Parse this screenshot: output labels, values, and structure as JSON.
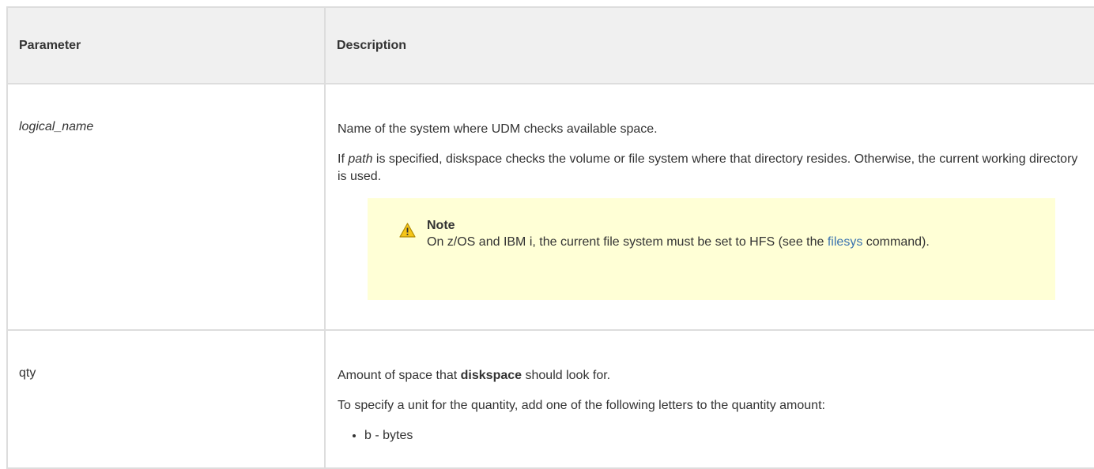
{
  "table": {
    "headers": {
      "parameter": "Parameter",
      "description": "Description"
    },
    "rows": [
      {
        "parameter": "logical_name",
        "description_1": "Name of the system where UDM checks available space.",
        "description_2_pre": "If ",
        "description_2_em": "path",
        "description_2_post": " is specified, diskspace checks the volume or file system where that directory resides. Otherwise, the current working directory is used.",
        "note": {
          "title": "Note",
          "text_pre": "On z/OS and IBM i, the current file system must be set to HFS (see the ",
          "link": "filesys",
          "text_post": " command)."
        }
      },
      {
        "parameter": "qty",
        "description_1_pre": "Amount of space that ",
        "description_1_bold": "diskspace",
        "description_1_post": " should look for.",
        "description_2": "To specify a unit for the quantity, add one of the following letters to the quantity amount:",
        "units": [
          "b - bytes"
        ]
      }
    ]
  },
  "colors": {
    "header_bg": "#f0f0f0",
    "note_bg": "#ffffd6",
    "link": "#3b73af",
    "border": "#dddddd"
  },
  "icons": {
    "note": "warning-icon"
  }
}
